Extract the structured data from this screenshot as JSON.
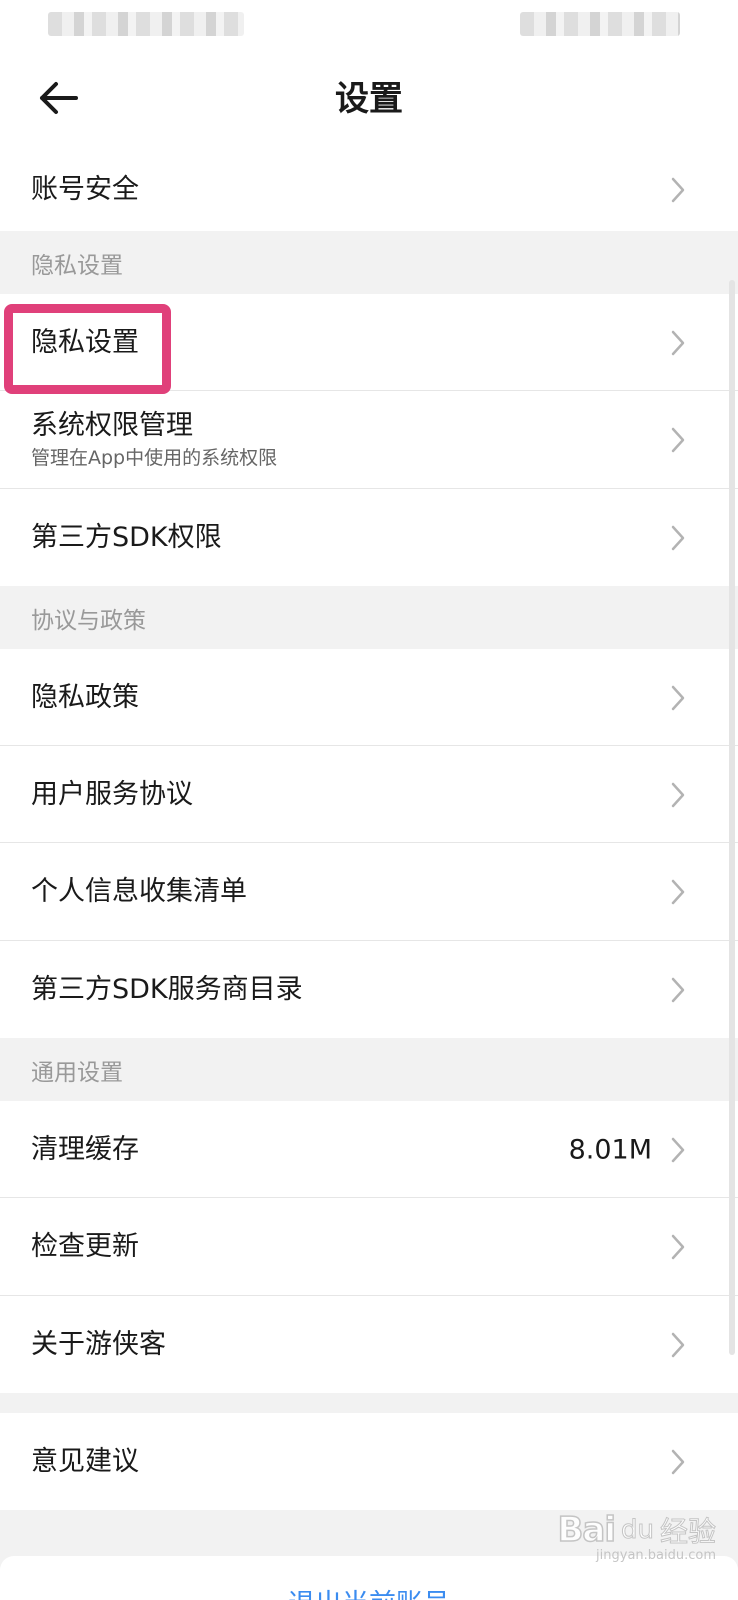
{
  "header": {
    "title": "设置"
  },
  "rows": {
    "account_security": "账号安全",
    "privacy_settings": "隐私设置",
    "system_permissions": "系统权限管理",
    "system_permissions_sub": "管理在App中使用的系统权限",
    "third_party_sdk_permissions": "第三方SDK权限",
    "privacy_policy": "隐私政策",
    "user_agreement": "用户服务协议",
    "personal_info_list": "个人信息收集清单",
    "third_party_sdk_directory": "第三方SDK服务商目录",
    "clear_cache": "清理缓存",
    "clear_cache_value": "8.01M",
    "check_update": "检查更新",
    "about": "关于游侠客",
    "feedback": "意见建议"
  },
  "sections": {
    "privacy": "隐私设置",
    "agreements": "协议与政策",
    "general": "通用设置"
  },
  "footer": {
    "logout_label": "退出当前账号"
  },
  "watermark": {
    "logo_text": "Bai",
    "paw": "du",
    "jingyan": "经验",
    "url": "jingyan.baidu.com"
  },
  "colors": {
    "highlight": "#e0407a",
    "link_blue": "#3b8cf0",
    "section_text": "#999999"
  }
}
